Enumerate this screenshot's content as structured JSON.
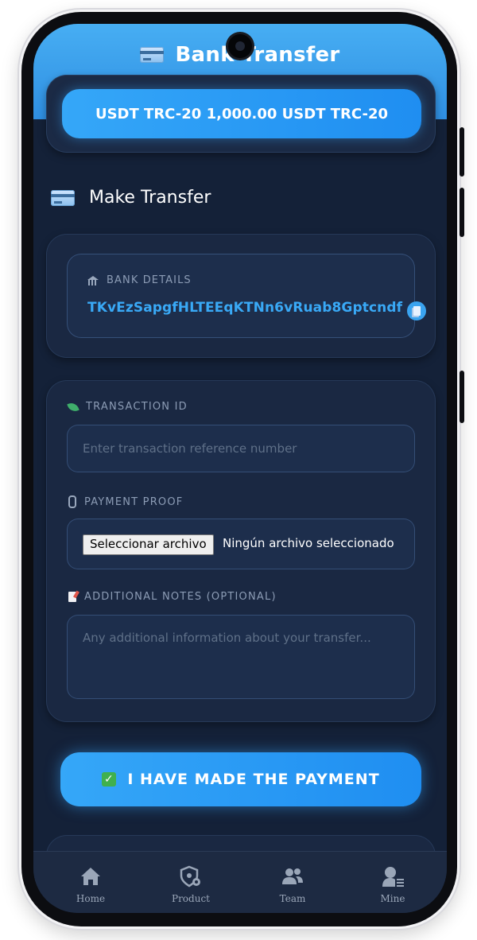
{
  "header": {
    "title": "Bank Transfer",
    "icon": "credit-card-icon"
  },
  "amount": {
    "text": "USDT TRC-20 1,000.00 USDT TRC-20"
  },
  "section": {
    "title": "Make Transfer"
  },
  "bank": {
    "label": "BANK DETAILS",
    "value": "TKvEzSapgfHLTEEqKTNn6vRuab8Gptcndf"
  },
  "form": {
    "transaction_label": "TRANSACTION ID",
    "transaction_placeholder": "Enter transaction reference number",
    "proof_label": "PAYMENT PROOF",
    "file_button": "Seleccionar archivo",
    "file_status": "Ningún archivo seleccionado",
    "notes_label": "ADDITIONAL NOTES (OPTIONAL)",
    "notes_placeholder": "Any additional information about your transfer..."
  },
  "submit": {
    "label": "I HAVE MADE THE PAYMENT"
  },
  "nav": [
    {
      "label": "Home",
      "icon": "home-icon"
    },
    {
      "label": "Product",
      "icon": "shield-gear-icon"
    },
    {
      "label": "Team",
      "icon": "team-icon"
    },
    {
      "label": "Mine",
      "icon": "user-icon"
    }
  ],
  "colors": {
    "accent": "#2f9cf2",
    "background": "#142138",
    "card": "#1a2842",
    "link": "#39a9f6"
  }
}
